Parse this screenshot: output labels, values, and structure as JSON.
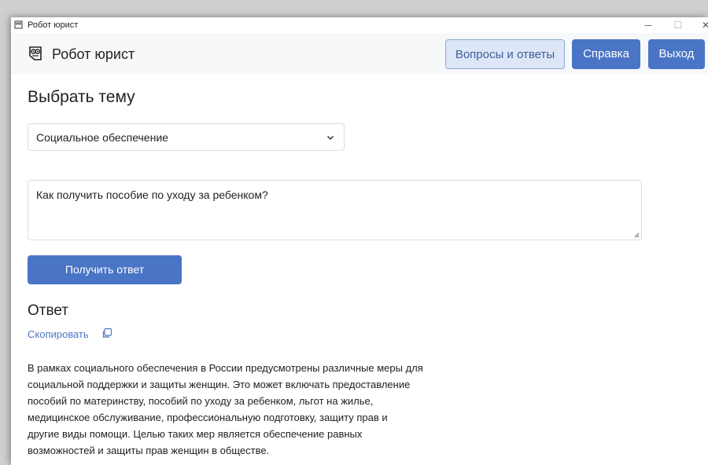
{
  "window": {
    "title": "Робот юрист",
    "controls": {
      "minimize": "─",
      "maximize": "☐",
      "close": "✕"
    }
  },
  "header": {
    "brand": "Робот юрист",
    "buttons": {
      "faq": "Вопросы и ответы",
      "help": "Справка",
      "exit": "Выход"
    }
  },
  "topic": {
    "heading": "Выбрать тему",
    "selected": "Социальное обеспечение"
  },
  "question": {
    "value": "Как получить пособие по уходу за ребенком?"
  },
  "submit_label": "Получить ответ",
  "answer": {
    "heading": "Ответ",
    "copy_label": "Скопировать",
    "lines": [
      "В рамках социального обеспечения в России предусмотрены различные меры для",
      "социальной поддержки и защиты женщин. Это может включать предоставление",
      "пособий по материнству, пособий по уходу за ребенком, льгот на жилье,",
      "медицинское обслуживание, профессиональную подготовку, защиту прав и",
      "другие виды помощи. Целью таких мер является обеспечение равных",
      "возможностей и защиты прав женщин в обществе."
    ]
  },
  "colors": {
    "accent": "#4a75c6",
    "secondary_bg": "#dce6f7",
    "header_bg": "#f7f8fa"
  },
  "icons": {
    "app": "owl-icon",
    "dropdown": "chevron-down-icon",
    "copy": "copy-icon",
    "resize": "resize-grip-icon"
  }
}
